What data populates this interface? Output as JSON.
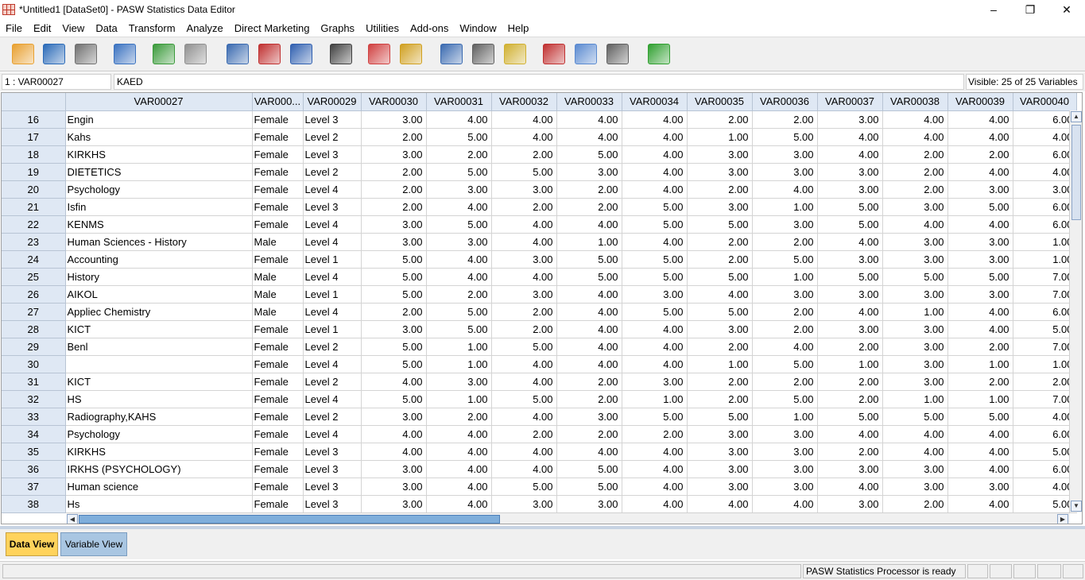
{
  "window": {
    "title": "*Untitled1 [DataSet0] - PASW Statistics Data Editor",
    "min": "–",
    "max": "❐",
    "close": "✕"
  },
  "menu": [
    "File",
    "Edit",
    "View",
    "Data",
    "Transform",
    "Analyze",
    "Direct Marketing",
    "Graphs",
    "Utilities",
    "Add-ons",
    "Window",
    "Help"
  ],
  "toolbar": {
    "icons": [
      {
        "name": "open-folder-icon",
        "color": "#e8a030"
      },
      {
        "name": "save-icon",
        "color": "#2a6ab8"
      },
      {
        "name": "print-icon",
        "color": "#707070"
      },
      {
        "name": "recall-dialog-icon",
        "color": "#3a72c0"
      },
      {
        "name": "undo-icon",
        "color": "#3a9a3a"
      },
      {
        "name": "redo-icon",
        "color": "#909090"
      },
      {
        "name": "goto-case-icon",
        "color": "#3a6ab0"
      },
      {
        "name": "goto-variable-icon",
        "color": "#c03030"
      },
      {
        "name": "variables-icon",
        "color": "#3060b0"
      },
      {
        "name": "find-icon",
        "color": "#404040"
      },
      {
        "name": "insert-cases-icon",
        "color": "#d04040"
      },
      {
        "name": "insert-variable-icon",
        "color": "#d0a020"
      },
      {
        "name": "split-file-icon",
        "color": "#3a6ab0"
      },
      {
        "name": "weight-cases-icon",
        "color": "#606060"
      },
      {
        "name": "select-cases-icon",
        "color": "#d0b030"
      },
      {
        "name": "value-labels-icon",
        "color": "#c03030"
      },
      {
        "name": "use-sets-icon",
        "color": "#5a8ad0"
      },
      {
        "name": "show-all-variables-icon",
        "color": "#606060"
      },
      {
        "name": "spell-check-icon",
        "color": "#30a030"
      }
    ]
  },
  "cellbar": {
    "ref": "1 : VAR00027",
    "value": "KAED",
    "visible": "Visible: 25 of 25 Variables"
  },
  "columns": [
    "VAR00027",
    "VAR000...",
    "VAR00029",
    "VAR00030",
    "VAR00031",
    "VAR00032",
    "VAR00033",
    "VAR00034",
    "VAR00035",
    "VAR00036",
    "VAR00037",
    "VAR00038",
    "VAR00039",
    "VAR00040"
  ],
  "rows": [
    {
      "n": "16",
      "c": [
        "Engin",
        "Female",
        "Level 3",
        "3.00",
        "4.00",
        "4.00",
        "4.00",
        "4.00",
        "2.00",
        "2.00",
        "3.00",
        "4.00",
        "4.00",
        "6.00"
      ]
    },
    {
      "n": "17",
      "c": [
        "Kahs",
        "Female",
        "Level 2",
        "2.00",
        "5.00",
        "4.00",
        "4.00",
        "4.00",
        "1.00",
        "5.00",
        "4.00",
        "4.00",
        "4.00",
        "4.00"
      ]
    },
    {
      "n": "18",
      "c": [
        "KIRKHS",
        "Female",
        "Level 3",
        "3.00",
        "2.00",
        "2.00",
        "5.00",
        "4.00",
        "3.00",
        "3.00",
        "4.00",
        "2.00",
        "2.00",
        "6.00"
      ]
    },
    {
      "n": "19",
      "c": [
        "DIETETICS",
        "Female",
        "Level 2",
        "2.00",
        "5.00",
        "5.00",
        "3.00",
        "4.00",
        "3.00",
        "3.00",
        "3.00",
        "2.00",
        "4.00",
        "4.00"
      ]
    },
    {
      "n": "20",
      "c": [
        "Psychology",
        "Female",
        "Level 4",
        "2.00",
        "3.00",
        "3.00",
        "2.00",
        "4.00",
        "2.00",
        "4.00",
        "3.00",
        "2.00",
        "3.00",
        "3.00"
      ]
    },
    {
      "n": "21",
      "c": [
        "Isfin",
        "Female",
        "Level 3",
        "2.00",
        "4.00",
        "2.00",
        "2.00",
        "5.00",
        "3.00",
        "1.00",
        "5.00",
        "3.00",
        "5.00",
        "6.00"
      ]
    },
    {
      "n": "22",
      "c": [
        "KENMS",
        "Female",
        "Level 4",
        "3.00",
        "5.00",
        "4.00",
        "4.00",
        "5.00",
        "5.00",
        "3.00",
        "5.00",
        "4.00",
        "4.00",
        "6.00"
      ]
    },
    {
      "n": "23",
      "c": [
        "Human Sciences - History",
        "Male",
        "Level 4",
        "3.00",
        "3.00",
        "4.00",
        "1.00",
        "4.00",
        "2.00",
        "2.00",
        "4.00",
        "3.00",
        "3.00",
        "1.00"
      ]
    },
    {
      "n": "24",
      "c": [
        "Accounting",
        "Female",
        "Level 1",
        "5.00",
        "4.00",
        "3.00",
        "5.00",
        "5.00",
        "2.00",
        "5.00",
        "3.00",
        "3.00",
        "3.00",
        "1.00"
      ]
    },
    {
      "n": "25",
      "c": [
        "History",
        "Male",
        "Level 4",
        "5.00",
        "4.00",
        "4.00",
        "5.00",
        "5.00",
        "5.00",
        "1.00",
        "5.00",
        "5.00",
        "5.00",
        "7.00"
      ]
    },
    {
      "n": "26",
      "c": [
        "AIKOL",
        "Male",
        "Level 1",
        "5.00",
        "2.00",
        "3.00",
        "4.00",
        "3.00",
        "4.00",
        "3.00",
        "3.00",
        "3.00",
        "3.00",
        "7.00"
      ]
    },
    {
      "n": "27",
      "c": [
        "Appliec Chemistry",
        "Male",
        "Level 4",
        "2.00",
        "5.00",
        "2.00",
        "4.00",
        "5.00",
        "5.00",
        "2.00",
        "4.00",
        "1.00",
        "4.00",
        "6.00"
      ]
    },
    {
      "n": "28",
      "c": [
        "KICT",
        "Female",
        "Level 1",
        "3.00",
        "5.00",
        "2.00",
        "4.00",
        "4.00",
        "3.00",
        "2.00",
        "3.00",
        "3.00",
        "4.00",
        "5.00"
      ]
    },
    {
      "n": "29",
      "c": [
        "Benl",
        "Female",
        "Level 2",
        "5.00",
        "1.00",
        "5.00",
        "4.00",
        "4.00",
        "2.00",
        "4.00",
        "2.00",
        "3.00",
        "2.00",
        "7.00"
      ]
    },
    {
      "n": "30",
      "c": [
        "",
        "Female",
        "Level 4",
        "5.00",
        "1.00",
        "4.00",
        "4.00",
        "4.00",
        "1.00",
        "5.00",
        "1.00",
        "3.00",
        "1.00",
        "1.00"
      ]
    },
    {
      "n": "31",
      "c": [
        "KICT",
        "Female",
        "Level 2",
        "4.00",
        "3.00",
        "4.00",
        "2.00",
        "3.00",
        "2.00",
        "2.00",
        "2.00",
        "3.00",
        "2.00",
        "2.00"
      ]
    },
    {
      "n": "32",
      "c": [
        "HS",
        "Female",
        "Level 4",
        "5.00",
        "1.00",
        "5.00",
        "2.00",
        "1.00",
        "2.00",
        "5.00",
        "2.00",
        "1.00",
        "1.00",
        "7.00"
      ]
    },
    {
      "n": "33",
      "c": [
        "Radiography,KAHS",
        "Female",
        "Level 2",
        "3.00",
        "2.00",
        "4.00",
        "3.00",
        "5.00",
        "5.00",
        "1.00",
        "5.00",
        "5.00",
        "5.00",
        "4.00"
      ]
    },
    {
      "n": "34",
      "c": [
        "Psychology",
        "Female",
        "Level 4",
        "4.00",
        "4.00",
        "2.00",
        "2.00",
        "2.00",
        "3.00",
        "3.00",
        "4.00",
        "4.00",
        "4.00",
        "6.00"
      ]
    },
    {
      "n": "35",
      "c": [
        "KIRKHS",
        "Female",
        "Level 3",
        "4.00",
        "4.00",
        "4.00",
        "4.00",
        "4.00",
        "3.00",
        "3.00",
        "2.00",
        "4.00",
        "4.00",
        "5.00"
      ]
    },
    {
      "n": "36",
      "c": [
        "IRKHS (PSYCHOLOGY)",
        "Female",
        "Level 3",
        "3.00",
        "4.00",
        "4.00",
        "5.00",
        "4.00",
        "3.00",
        "3.00",
        "3.00",
        "3.00",
        "4.00",
        "6.00"
      ]
    },
    {
      "n": "37",
      "c": [
        "Human science",
        "Female",
        "Level 3",
        "3.00",
        "4.00",
        "5.00",
        "5.00",
        "4.00",
        "3.00",
        "3.00",
        "4.00",
        "3.00",
        "3.00",
        "4.00"
      ]
    },
    {
      "n": "38",
      "c": [
        "Hs",
        "Female",
        "Level 3",
        "3.00",
        "4.00",
        "3.00",
        "3.00",
        "4.00",
        "4.00",
        "4.00",
        "3.00",
        "2.00",
        "4.00",
        "5.00"
      ]
    }
  ],
  "tabs": {
    "data_view": "Data View",
    "variable_view": "Variable View"
  },
  "status": {
    "processor": "PASW Statistics Processor is ready"
  }
}
